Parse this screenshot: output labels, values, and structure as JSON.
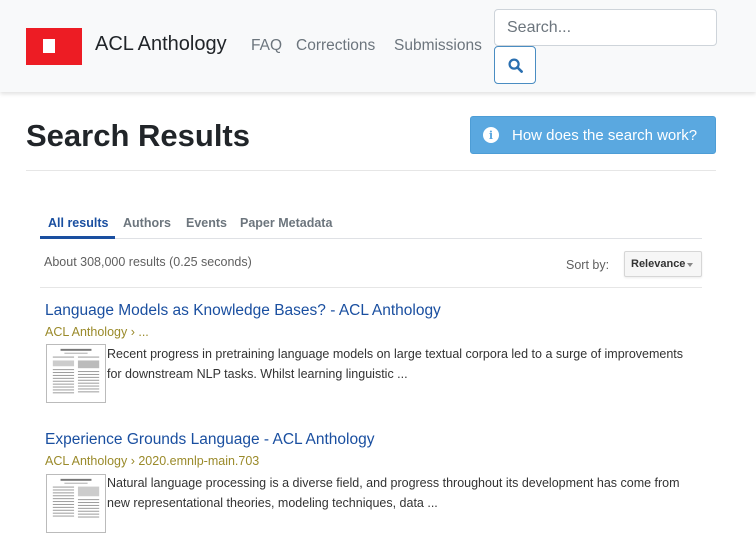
{
  "navbar": {
    "brand": "ACL Anthology",
    "links": [
      "FAQ",
      "Corrections",
      "Submissions"
    ],
    "search_placeholder": "Search..."
  },
  "header": {
    "title": "Search Results",
    "help_button": "How does the search work?"
  },
  "tabs": [
    "All results",
    "Authors",
    "Events",
    "Paper Metadata"
  ],
  "results_info": {
    "count_text": "About 308,000 results (0.25 seconds)",
    "sort_label": "Sort by:",
    "sort_value": "Relevance"
  },
  "results": [
    {
      "title": "Language Models as Knowledge Bases? - ACL Anthology",
      "url": "ACL Anthology › ...",
      "snippet": "Recent progress in pretraining language models on large textual corpora led to a surge of improvements for downstream NLP tasks. Whilst learning linguistic ..."
    },
    {
      "title": "Experience Grounds Language - ACL Anthology",
      "url": "ACL Anthology › 2020.emnlp-main.703",
      "snippet": "Natural language processing is a diverse field, and progress throughout its development has come from new representational theories, modeling techniques, data ..."
    }
  ],
  "colors": {
    "brand_red": "#ed1c24",
    "link_blue": "#1a4fa0",
    "help_button": "#5aa8e0"
  }
}
